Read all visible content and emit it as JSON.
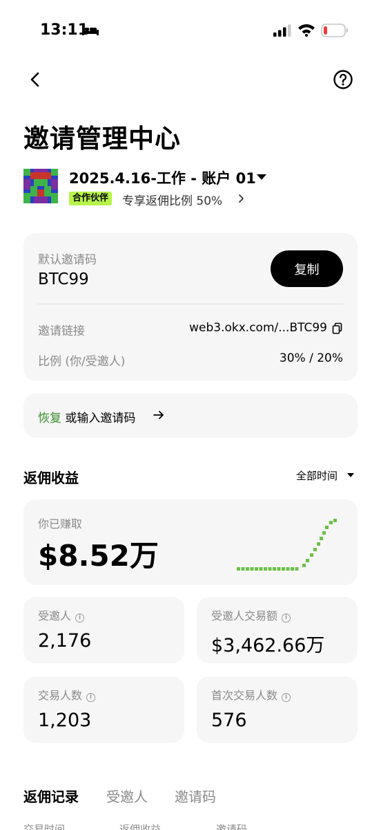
{
  "status_bar": {
    "time": "13:11"
  },
  "header": {
    "title": "邀请管理中心"
  },
  "account": {
    "name": "2025.4.16-工作 - 账户 01",
    "badge": "合作伙伴",
    "rebate_ratio": "专享返佣比例 50%"
  },
  "invite": {
    "code_label": "默认邀请码",
    "code_value": "BTC99",
    "copy_label": "复制",
    "link_label": "邀请链接",
    "link_value": "web3.okx.com/...BTC99",
    "ratio_label": "比例 (你/受邀人)",
    "ratio_value": "30% / 20%"
  },
  "restore": {
    "green_text": "恢复",
    "rest_text": " 或输入邀请码"
  },
  "earnings": {
    "section_title": "返佣收益",
    "time_filter": "全部时间",
    "earned_label": "你已赚取",
    "earned_value": "$8.52万"
  },
  "stats": [
    {
      "label": "受邀人",
      "value": "2,176"
    },
    {
      "label": "受邀人交易额",
      "value": "$3,462.66万"
    },
    {
      "label": "交易人数",
      "value": "1,203"
    },
    {
      "label": "首次交易人数",
      "value": "576"
    }
  ],
  "tabs": [
    {
      "label": "返佣记录"
    },
    {
      "label": "受邀人"
    },
    {
      "label": "邀请码"
    }
  ],
  "columns": [
    {
      "label": "交易时间"
    },
    {
      "label": "返佣收益"
    },
    {
      "label": "邀请码"
    }
  ],
  "colors": {
    "accent_green": "#b7f34a",
    "link_green": "#3a8c2f",
    "sparkline_green": "#6cc04a"
  }
}
